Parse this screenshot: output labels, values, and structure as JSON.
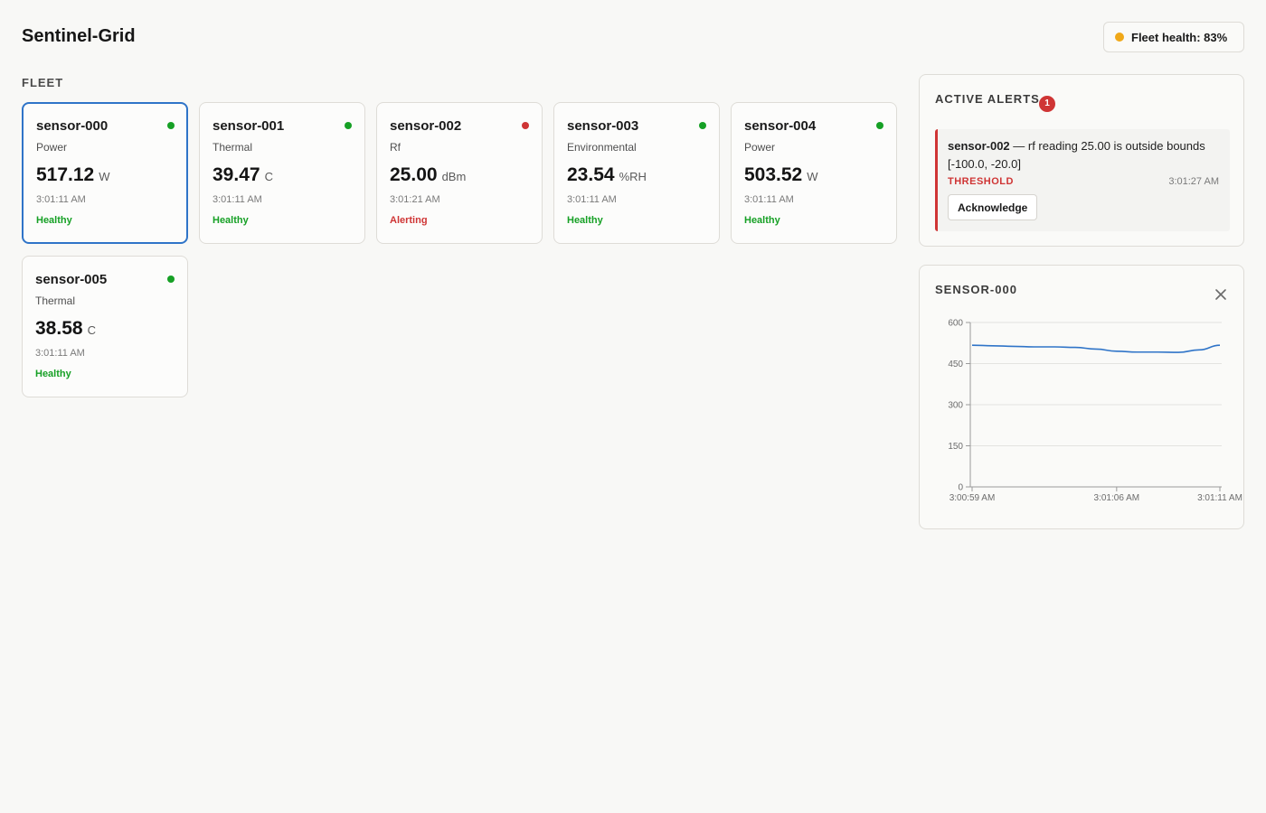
{
  "header": {
    "title": "Sentinel-Grid",
    "fleet_health_label": "Fleet health: 83%",
    "fleet_health_color": "#f0a818"
  },
  "fleet": {
    "label": "FLEET",
    "sensors": [
      {
        "id": "sensor-000",
        "type": "Power",
        "value": "517.12",
        "unit": "W",
        "time": "3:01:11 AM",
        "status": "Healthy",
        "status_color": "#16a025",
        "selected": true
      },
      {
        "id": "sensor-001",
        "type": "Thermal",
        "value": "39.47",
        "unit": "C",
        "time": "3:01:11 AM",
        "status": "Healthy",
        "status_color": "#16a025",
        "selected": false
      },
      {
        "id": "sensor-002",
        "type": "Rf",
        "value": "25.00",
        "unit": "dBm",
        "time": "3:01:21 AM",
        "status": "Alerting",
        "status_color": "#cf3535",
        "selected": false
      },
      {
        "id": "sensor-003",
        "type": "Environmental",
        "value": "23.54",
        "unit": "%RH",
        "time": "3:01:11 AM",
        "status": "Healthy",
        "status_color": "#16a025",
        "selected": false
      },
      {
        "id": "sensor-004",
        "type": "Power",
        "value": "503.52",
        "unit": "W",
        "time": "3:01:11 AM",
        "status": "Healthy",
        "status_color": "#16a025",
        "selected": false
      },
      {
        "id": "sensor-005",
        "type": "Thermal",
        "value": "38.58",
        "unit": "C",
        "time": "3:01:11 AM",
        "status": "Healthy",
        "status_color": "#16a025",
        "selected": false
      }
    ]
  },
  "alerts": {
    "heading": "ACTIVE ALERTS",
    "count": "1",
    "badge_color": "#cf3535",
    "items": [
      {
        "sensor": "sensor-002",
        "message": " — rf reading 25.00 is outside bounds [-100.0, -20.0]",
        "kind": "THRESHOLD",
        "kind_color": "#cf3535",
        "time": "3:01:27 AM",
        "ack_label": "Acknowledge"
      }
    ]
  },
  "chart_panel": {
    "heading": "SENSOR-000",
    "close_icon": "close-icon"
  },
  "chart_data": {
    "type": "line",
    "title": "",
    "xlabel": "",
    "ylabel": "",
    "ylim": [
      0,
      600
    ],
    "yticks": [
      0,
      150,
      300,
      450,
      600
    ],
    "xticks": [
      "3:00:59 AM",
      "3:01:06 AM",
      "3:01:11 AM"
    ],
    "grid": true,
    "line_color": "#2f74c8",
    "series": [
      {
        "x": [
          "3:00:59 AM",
          "3:01:00 AM",
          "3:01:01 AM",
          "3:01:02 AM",
          "3:01:03 AM",
          "3:01:04 AM",
          "3:01:05 AM",
          "3:01:06 AM",
          "3:01:07 AM",
          "3:01:08 AM",
          "3:01:09 AM",
          "3:01:10 AM",
          "3:01:11 AM"
        ],
        "values": [
          517,
          515,
          513,
          511,
          511,
          509,
          503,
          495,
          492,
          492,
          491,
          500,
          517
        ]
      }
    ]
  }
}
